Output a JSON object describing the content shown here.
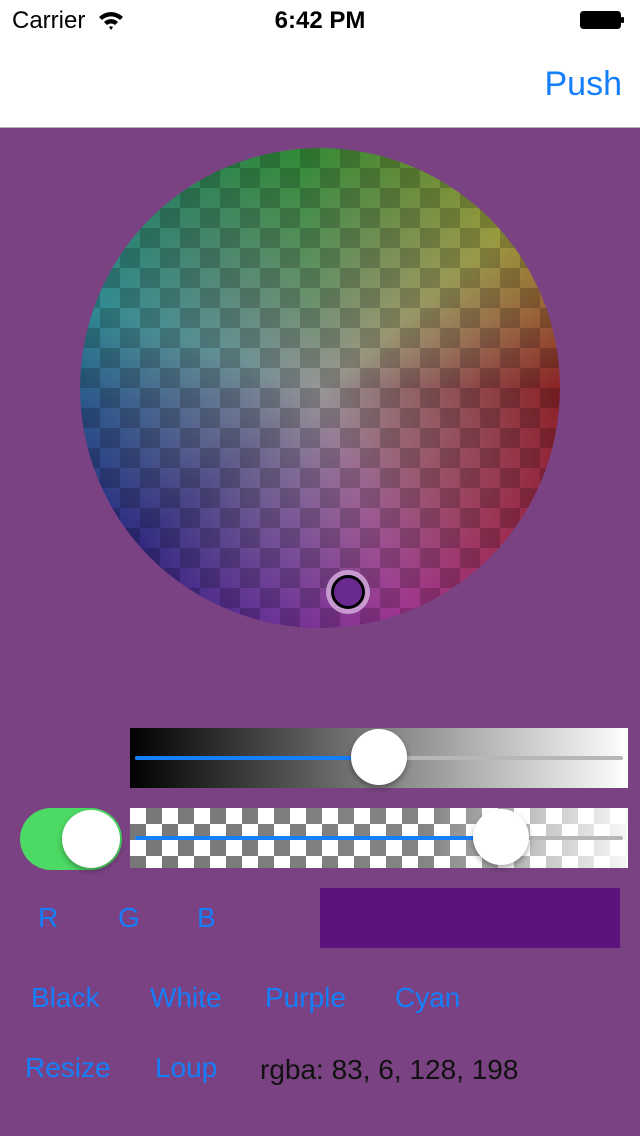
{
  "status_bar": {
    "carrier": "Carrier",
    "time": "6:42 PM",
    "wifi_icon": "wifi-icon",
    "battery_icon": "battery-full-icon"
  },
  "nav_bar": {
    "push_label": "Push"
  },
  "color_wheel": {
    "selected_hue_description": "purple",
    "cursor_icon": "color-picker-cursor"
  },
  "brightness_slider": {
    "value": 0.5
  },
  "alpha_slider": {
    "value": 0.75
  },
  "toggle": {
    "on": true,
    "color": "#4cd964"
  },
  "channel_buttons": [
    {
      "label": "R"
    },
    {
      "label": "G"
    },
    {
      "label": "B"
    }
  ],
  "swatch": {
    "color": "#5c137d"
  },
  "preset_buttons": [
    {
      "label": "Black"
    },
    {
      "label": "White"
    },
    {
      "label": "Purple"
    },
    {
      "label": "Cyan"
    }
  ],
  "action_buttons": [
    {
      "label": "Resize"
    },
    {
      "label": "Loup"
    }
  ],
  "rgba_readout": "rgba: 83, 6, 128, 198",
  "colors": {
    "background": "#7a4282",
    "accent": "#157efb"
  }
}
